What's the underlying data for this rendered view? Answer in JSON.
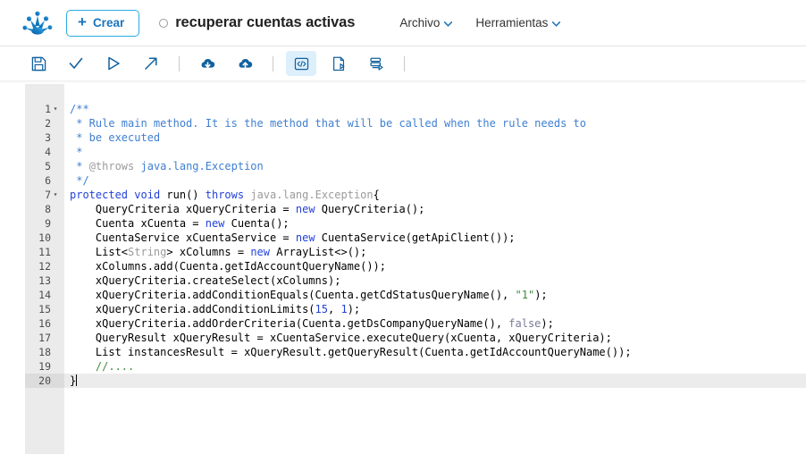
{
  "app": {
    "logo_icon": "bizagi-frog-foot-logo",
    "accent_blue": "#1b75bc",
    "accent_cyan": "#2aabe2"
  },
  "header": {
    "create_button": {
      "label": "Crear",
      "plus": "+"
    },
    "document": {
      "status_icon": "unsaved-circle-icon",
      "title": "recuperar cuentas activas"
    },
    "menus": [
      {
        "label": "Archivo",
        "chevron": "∨"
      },
      {
        "label": "Herramientas",
        "chevron": "∨"
      }
    ]
  },
  "toolbar": {
    "buttons": [
      {
        "name": "save-button",
        "icon": "floppy-disk-icon",
        "title": "Guardar",
        "active": false
      },
      {
        "name": "validate-button",
        "icon": "check-icon",
        "title": "Validar",
        "active": false
      },
      {
        "name": "run-button",
        "icon": "play-icon",
        "title": "Ejecutar",
        "active": false
      },
      {
        "name": "export-button",
        "icon": "external-link-icon",
        "title": "Exportar",
        "active": false
      },
      {
        "name": "separator-1",
        "icon": "separator",
        "title": "",
        "active": false
      },
      {
        "name": "download-button",
        "icon": "cloud-download-icon",
        "title": "Descargar",
        "active": false
      },
      {
        "name": "upload-button",
        "icon": "cloud-upload-icon",
        "title": "Cargar",
        "active": false
      },
      {
        "name": "separator-2",
        "icon": "separator",
        "title": "",
        "active": false
      },
      {
        "name": "code-view-button",
        "icon": "code-brackets-icon",
        "title": "Codigo",
        "active": true
      },
      {
        "name": "document-export-button",
        "icon": "document-arrow-icon",
        "title": "",
        "active": false
      },
      {
        "name": "layers-export-button",
        "icon": "stacked-layers-arrow-icon",
        "title": "",
        "active": false
      },
      {
        "name": "separator-3",
        "icon": "separator",
        "title": "",
        "active": false
      }
    ]
  },
  "editor": {
    "language": "java",
    "current_line": 20,
    "total_lines": 20,
    "lines": [
      {
        "n": 1,
        "fold": "▾",
        "tokens": [
          {
            "c": "t-cmt",
            "t": "/**"
          }
        ]
      },
      {
        "n": 2,
        "fold": "",
        "tokens": [
          {
            "c": "t-cmt",
            "t": " * Rule main method. It is the method that will be called when the rule needs to"
          }
        ]
      },
      {
        "n": 3,
        "fold": "",
        "tokens": [
          {
            "c": "t-cmt",
            "t": " * be executed"
          }
        ]
      },
      {
        "n": 4,
        "fold": "",
        "tokens": [
          {
            "c": "t-cmt",
            "t": " *"
          }
        ]
      },
      {
        "n": 5,
        "fold": "",
        "tokens": [
          {
            "c": "t-cmt",
            "t": " * "
          },
          {
            "c": "t-tag",
            "t": "@throws"
          },
          {
            "c": "t-cmt",
            "t": " java.lang.Exception"
          }
        ]
      },
      {
        "n": 6,
        "fold": "",
        "tokens": [
          {
            "c": "t-cmt",
            "t": " */"
          }
        ]
      },
      {
        "n": 7,
        "fold": "▾",
        "tokens": [
          {
            "c": "t-kw",
            "t": "protected"
          },
          {
            "c": "t-plain",
            "t": " "
          },
          {
            "c": "t-kw",
            "t": "void"
          },
          {
            "c": "t-plain",
            "t": " run() "
          },
          {
            "c": "t-kw",
            "t": "throws"
          },
          {
            "c": "t-plain",
            "t": " "
          },
          {
            "c": "t-type",
            "t": "java.lang.Exception"
          },
          {
            "c": "t-plain",
            "t": "{"
          }
        ]
      },
      {
        "n": 8,
        "fold": "",
        "tokens": [
          {
            "c": "t-plain",
            "t": "    QueryCriteria xQueryCriteria = "
          },
          {
            "c": "t-kw",
            "t": "new"
          },
          {
            "c": "t-plain",
            "t": " QueryCriteria();"
          }
        ]
      },
      {
        "n": 9,
        "fold": "",
        "tokens": [
          {
            "c": "t-plain",
            "t": "    Cuenta xCuenta = "
          },
          {
            "c": "t-kw",
            "t": "new"
          },
          {
            "c": "t-plain",
            "t": " Cuenta();"
          }
        ]
      },
      {
        "n": 10,
        "fold": "",
        "tokens": [
          {
            "c": "t-plain",
            "t": "    CuentaService xCuentaService = "
          },
          {
            "c": "t-kw",
            "t": "new"
          },
          {
            "c": "t-plain",
            "t": " CuentaService(getApiClient());"
          }
        ]
      },
      {
        "n": 11,
        "fold": "",
        "tokens": [
          {
            "c": "t-plain",
            "t": "    List<"
          },
          {
            "c": "t-type",
            "t": "String"
          },
          {
            "c": "t-plain",
            "t": "> xColumns = "
          },
          {
            "c": "t-kw",
            "t": "new"
          },
          {
            "c": "t-plain",
            "t": " ArrayList<>();"
          }
        ]
      },
      {
        "n": 12,
        "fold": "",
        "tokens": [
          {
            "c": "t-plain",
            "t": "    xColumns.add(Cuenta.getIdAccountQueryName());"
          }
        ]
      },
      {
        "n": 13,
        "fold": "",
        "tokens": [
          {
            "c": "t-plain",
            "t": "    xQueryCriteria.createSelect(xColumns);"
          }
        ]
      },
      {
        "n": 14,
        "fold": "",
        "tokens": [
          {
            "c": "t-plain",
            "t": "    xQueryCriteria.addConditionEquals(Cuenta.getCdStatusQueryName(), "
          },
          {
            "c": "t-str",
            "t": "\"1\""
          },
          {
            "c": "t-plain",
            "t": ");"
          }
        ]
      },
      {
        "n": 15,
        "fold": "",
        "tokens": [
          {
            "c": "t-plain",
            "t": "    xQueryCriteria.addConditionLimits("
          },
          {
            "c": "t-num",
            "t": "15"
          },
          {
            "c": "t-plain",
            "t": ", "
          },
          {
            "c": "t-num",
            "t": "1"
          },
          {
            "c": "t-plain",
            "t": ");"
          }
        ]
      },
      {
        "n": 16,
        "fold": "",
        "tokens": [
          {
            "c": "t-plain",
            "t": "    xQueryCriteria.addOrderCriteria(Cuenta.getDsCompanyQueryName(), "
          },
          {
            "c": "t-bool",
            "t": "false"
          },
          {
            "c": "t-plain",
            "t": ");"
          }
        ]
      },
      {
        "n": 17,
        "fold": "",
        "tokens": [
          {
            "c": "t-plain",
            "t": "    QueryResult xQueryResult = xCuentaService.executeQuery(xCuenta, xQueryCriteria);"
          }
        ]
      },
      {
        "n": 18,
        "fold": "",
        "tokens": [
          {
            "c": "t-plain",
            "t": "    List instancesResult = xQueryResult.getQueryResult(Cuenta.getIdAccountQueryName());"
          }
        ]
      },
      {
        "n": 19,
        "fold": "",
        "tokens": [
          {
            "c": "t-lncmt",
            "t": "    //...."
          }
        ]
      },
      {
        "n": 20,
        "fold": "",
        "tokens": [
          {
            "c": "t-plain",
            "t": "}"
          }
        ]
      }
    ]
  }
}
